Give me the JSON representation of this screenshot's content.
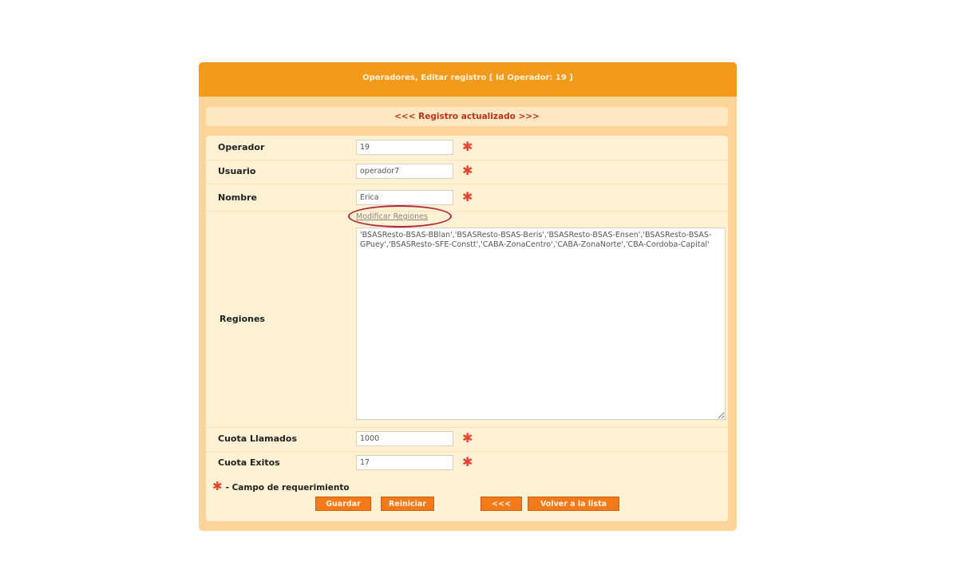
{
  "header": {
    "title": "Operadores, Editar registro [ Id Operador: 19 ]"
  },
  "notice": {
    "text": "<<< Registro actualizado >>>"
  },
  "fields": {
    "operador": {
      "label": "Operador",
      "value": "19"
    },
    "usuario": {
      "label": "Usuario",
      "value": "operador7"
    },
    "nombre": {
      "label": "Nombre",
      "value": "Erica"
    },
    "regiones": {
      "label": "Regiones",
      "link": "Modificar Regiones",
      "value": "'BSASResto-BSAS-BBlan','BSASResto-BSAS-Beris','BSASResto-BSAS-Ensen','BSASResto-BSAS-GPuey','BSASResto-SFE-Constt','CABA-ZonaCentro','CABA-ZonaNorte','CBA-Cordoba-Capital'"
    },
    "cuota_llamados": {
      "label": "Cuota Llamados",
      "value": "1000"
    },
    "cuota_exitos": {
      "label": "Cuota Exitos",
      "value": "17"
    }
  },
  "required_symbol": "✱",
  "legend": {
    "text": "- Campo de requerimiento"
  },
  "buttons": {
    "guardar": "Guardar",
    "reiniciar": "Reiniciar",
    "back": "<<<",
    "volver": "Volver a la lista"
  },
  "colors": {
    "header": "#f39a1b",
    "panel": "#fcd398",
    "required": "#e64532",
    "button": "#f37a1b",
    "notice_text": "#c0301c"
  }
}
